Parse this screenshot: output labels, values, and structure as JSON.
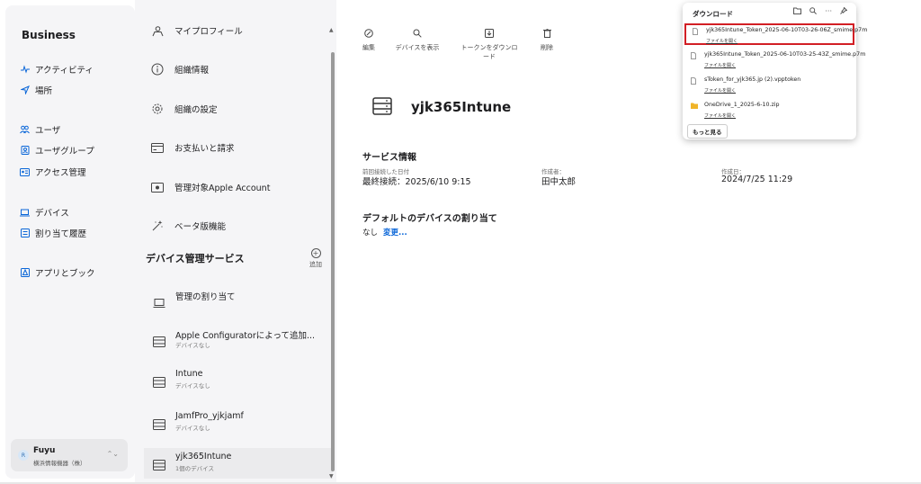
{
  "sidebar": {
    "brand": "Business",
    "items": [
      {
        "label": "アクティビティ",
        "icon": "activity-icon"
      },
      {
        "label": "場所",
        "icon": "location-arrow-icon"
      },
      {
        "label": "ユーザ",
        "icon": "users-icon"
      },
      {
        "label": "ユーザグループ",
        "icon": "user-group-icon"
      },
      {
        "label": "アクセス管理",
        "icon": "access-card-icon"
      },
      {
        "label": "デバイス",
        "icon": "laptop-icon"
      },
      {
        "label": "割り当て履歴",
        "icon": "list-icon"
      },
      {
        "label": "アプリとブック",
        "icon": "apps-icon"
      }
    ],
    "user": {
      "initial": "R",
      "name": "Fuyu",
      "org": "横浜情報機器（株）"
    }
  },
  "settings": {
    "items": [
      {
        "label": "マイプロフィール",
        "icon": "profile-icon"
      },
      {
        "label": "組織情報",
        "icon": "info-icon"
      },
      {
        "label": "組織の設定",
        "icon": "gear-icon"
      },
      {
        "label": "お支払いと請求",
        "icon": "credit-card-icon"
      },
      {
        "label": "管理対象Apple Account",
        "icon": "managed-account-icon"
      },
      {
        "label": "ベータ版機能",
        "icon": "sparkle-wand-icon"
      }
    ],
    "section_title": "デバイス管理サービス",
    "add_label": "追加",
    "services": [
      {
        "title": "管理の割り当て",
        "subtitle": ""
      },
      {
        "title": "Apple Configuratorによって追加...",
        "subtitle": "デバイスなし"
      },
      {
        "title": "Intune",
        "subtitle": "デバイスなし"
      },
      {
        "title": "JamfPro_yjkjamf",
        "subtitle": "デバイスなし"
      },
      {
        "title": "yjk365Intune",
        "subtitle": "1個のデバイス"
      }
    ]
  },
  "toolbar": {
    "edit": "編集",
    "show_devices": "デバイスを表示",
    "download_token_1": "トークンをダウンロ",
    "download_token_2": "ード",
    "delete": "削除"
  },
  "main": {
    "title": "yjk365Intune",
    "service_info_title": "サービス情報",
    "last_connected_label": "前回接続した日付",
    "last_connected_value": "最終接続：2025/6/10 9:15",
    "created_by_label": "作成者：",
    "created_by_value": "田中太郎",
    "created_on_label": "作成日：",
    "created_on_value": "2024/7/25 11:29",
    "default_assign_title": "デフォルトのデバイスの割り当て",
    "default_assign_value": "なし",
    "change_link": "変更..."
  },
  "downloads": {
    "title": "ダウンロード",
    "open_label": "ファイルを開く",
    "more_button": "もっと見る",
    "files": [
      {
        "name": "yjk365Intune_Token_2025-06-10T03-26-06Z_smime.p7m",
        "icon": "file-icon"
      },
      {
        "name": "yjk365Intune_Token_2025-06-10T03-25-43Z_smime.p7m",
        "icon": "file-icon"
      },
      {
        "name": "sToken_for_yjk365.jp (2).vpptoken",
        "icon": "file-icon"
      },
      {
        "name": "OneDrive_1_2025-6-10.zip",
        "icon": "folder-icon"
      }
    ],
    "highlight_color": "#d21f25"
  },
  "colors": {
    "accent": "#0a66d8",
    "sidebar_bg": "#f5f5f7"
  }
}
